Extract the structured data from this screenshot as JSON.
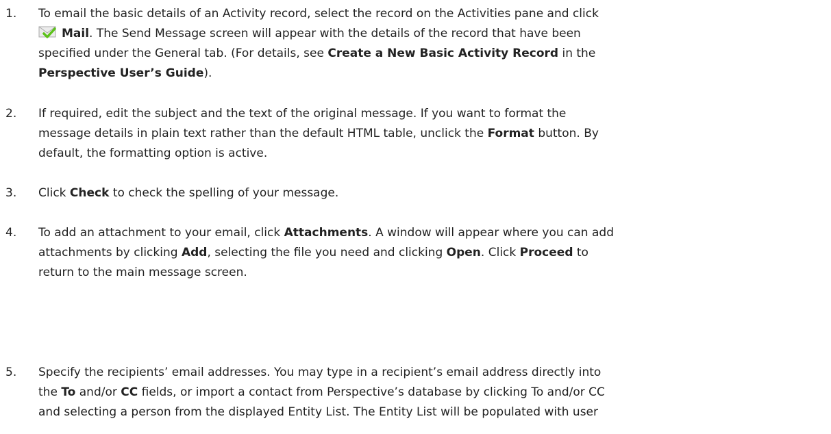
{
  "steps": [
    {
      "number": "1.",
      "l1": "To email the basic details of an Activity record, select the record on the Activities pane and click",
      "l2_bold": "Mail",
      "l2_rest": ". The Send Message screen will appear with the details of the record that have been",
      "l3a": "specified under the General tab. (For details, see ",
      "l3_bold": "Create a New Basic Activity Record",
      "l3b": " in the",
      "l4_bold": "Perspective User’s Guide",
      "l4_rest": ")."
    },
    {
      "number": "2.",
      "l1": "If required, edit the subject and the text of the original message. If you want to format the",
      "l2a": "message details in plain text rather than the default HTML table, unclick the ",
      "l2_bold": "Format",
      "l2b": " button. By",
      "l3": "default, the formatting option is active."
    },
    {
      "number": "3.",
      "l1a": "Click ",
      "l1_bold": "Check",
      "l1b": " to check the spelling of your message."
    },
    {
      "number": "4.",
      "l1a": "To add an attachment to your email, click ",
      "l1_bold": "Attachments",
      "l1b": ". A window will appear where you can add",
      "l2a": "attachments by clicking ",
      "l2_bold1": "Add",
      "l2b": ", selecting the file you need and clicking ",
      "l2_bold2": "Open",
      "l2c": ". Click ",
      "l2_bold3": "Proceed",
      "l2d": " to",
      "l3": "return to the main message screen."
    },
    {
      "number": "5.",
      "l1": "Specify the recipients’ email addresses. You may type in a recipient’s email address directly into",
      "l2a": "the ",
      "l2_bold1": "To",
      "l2b": " and/or ",
      "l2_bold2": "CC",
      "l2c": " fields, or import a contact from Perspective’s database by clicking To and/or CC",
      "l3": "and selecting a person from the displayed Entity List. The Entity List will be populated with user"
    }
  ],
  "icons": {
    "mail": "mail-checkmark-icon"
  },
  "colors": {
    "text": "#222222",
    "check_green": "#5cc21a",
    "envelope": "#e9e9e9"
  }
}
